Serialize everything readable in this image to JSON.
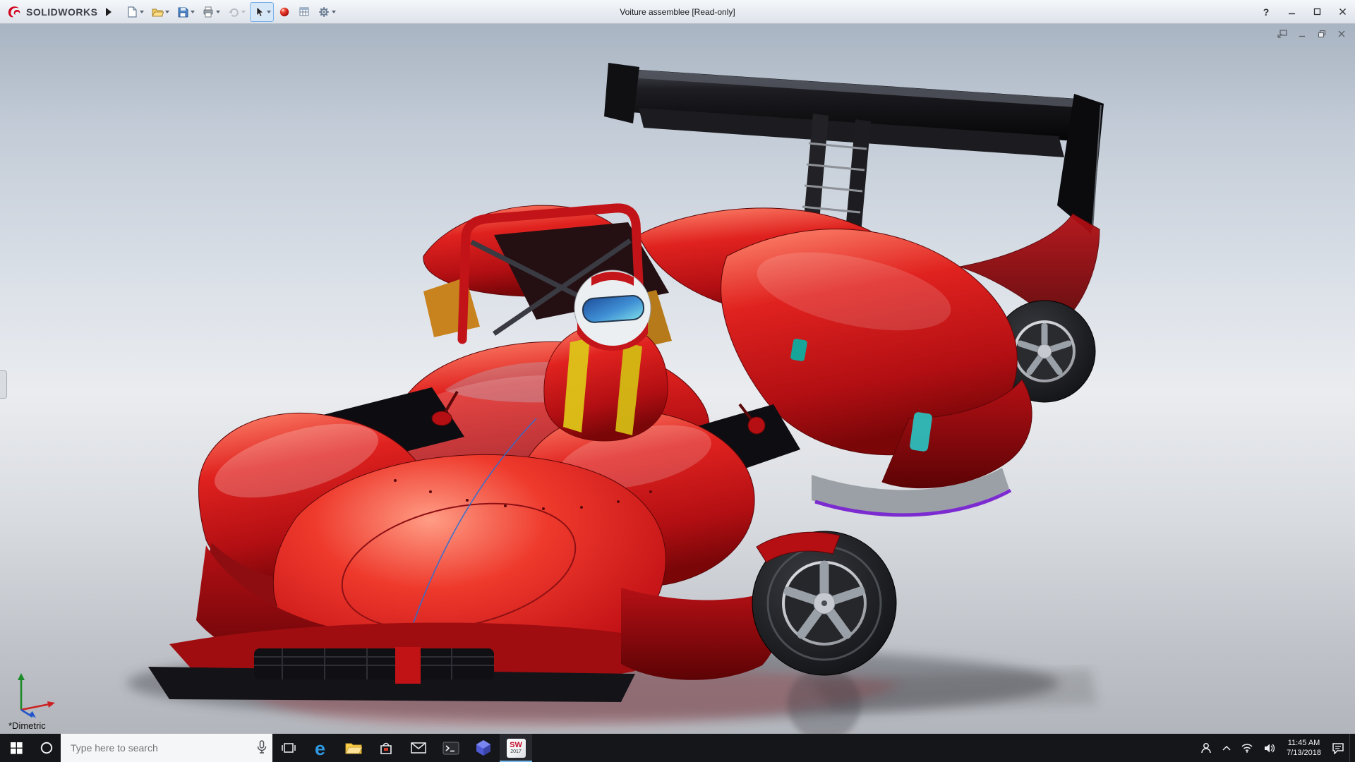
{
  "app": {
    "brand": "SOLIDWORKS",
    "title": "Voiture assemblee [Read-only]",
    "help_label": "?"
  },
  "titlebar": {
    "icons": [
      "new-document",
      "open",
      "save",
      "print",
      "undo",
      "select-arrow",
      "red-sphere",
      "spreadsheet",
      "options-gear"
    ],
    "window_controls": [
      "help",
      "minimize",
      "maximize",
      "close"
    ]
  },
  "document_window": {
    "controls": [
      "float",
      "minimize",
      "restore",
      "close"
    ]
  },
  "viewport": {
    "view_label": "*Dimetric",
    "model": "red prototype race car with driver, black rear wing",
    "triad_colors": {
      "x": "#cc2222",
      "y": "#1d8a2a",
      "z": "#2255cc"
    }
  },
  "taskbar": {
    "search_placeholder": "Type here to search",
    "clock_time": "11:45 AM",
    "clock_date": "7/13/2018",
    "edge_glyph": "e",
    "solidworks_label": "SW",
    "solidworks_year": "2017",
    "buttons": [
      "start",
      "cortana",
      "search",
      "task-view",
      "edge",
      "file-explorer",
      "store",
      "mail",
      "command-prompt",
      "purple-app",
      "solidworks-2017"
    ],
    "tray": [
      "people",
      "hidden-icons",
      "network",
      "volume",
      "clock",
      "action-center",
      "show-desktop"
    ]
  },
  "colors": {
    "body_red": "#cf1418",
    "wing_black": "#0c0c0e",
    "taskbar_bg": "#15161a",
    "titlebar_bg": "#e9edf2"
  }
}
